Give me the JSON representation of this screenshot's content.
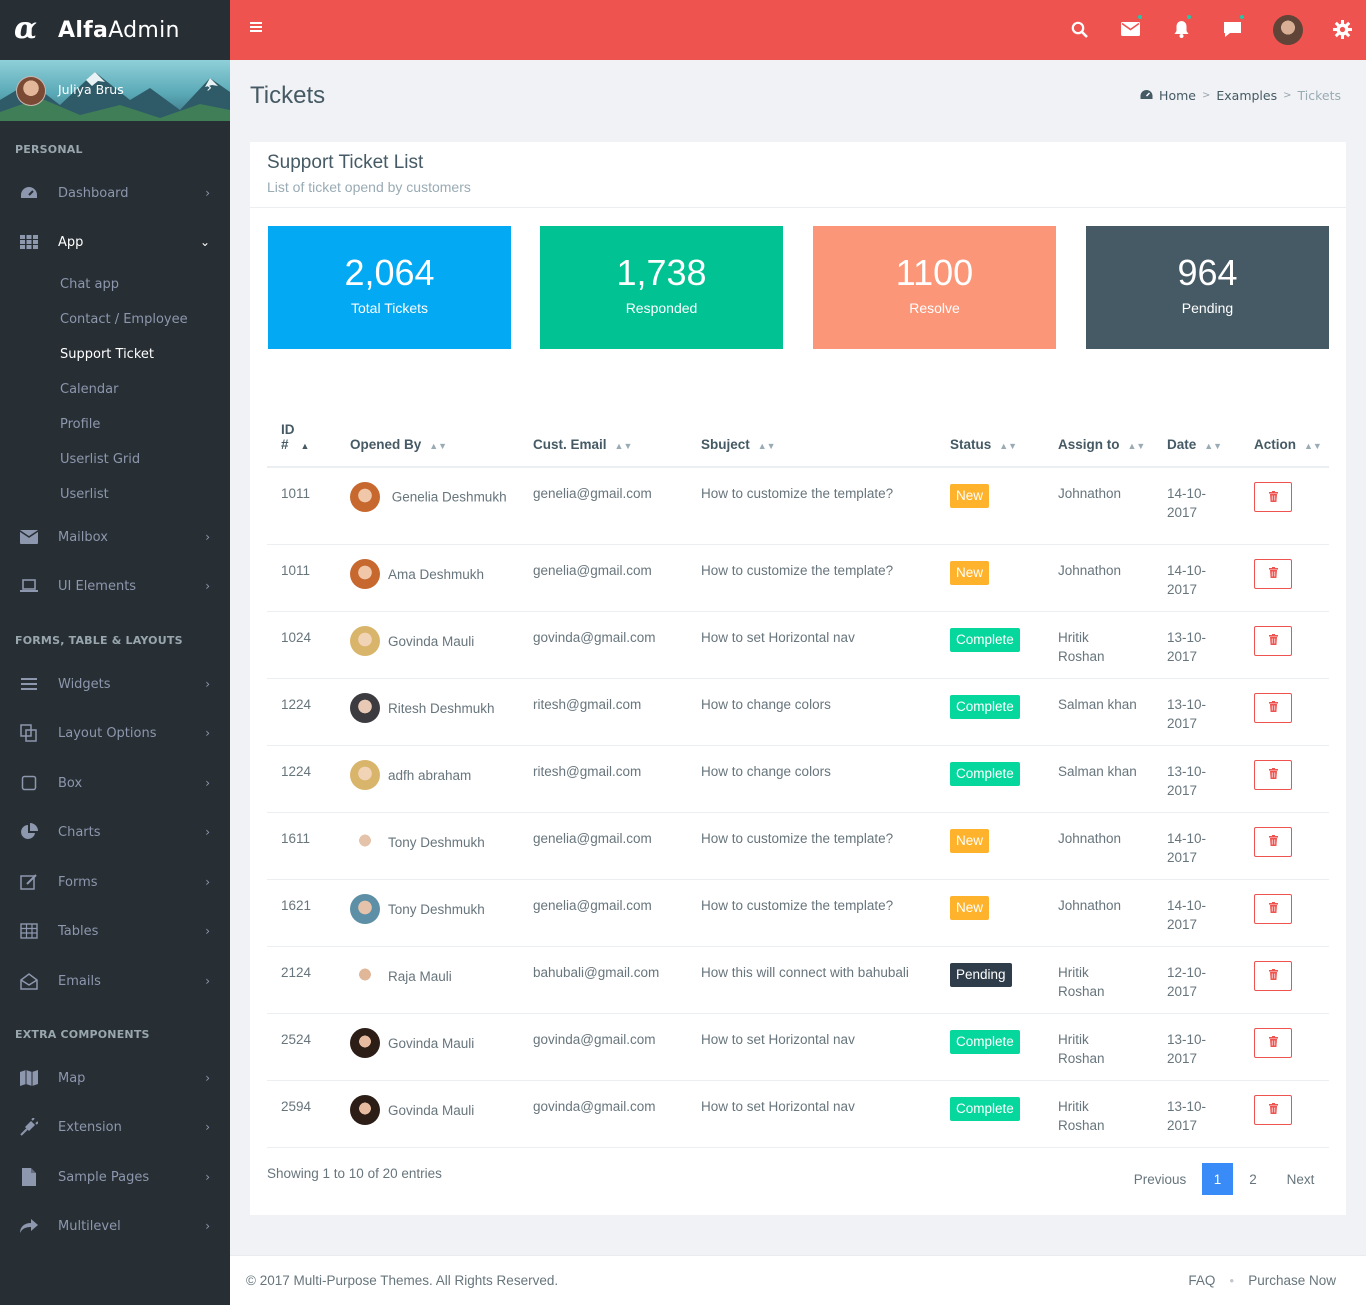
{
  "brand": {
    "name_bold": "Alfa",
    "name_light": "Admin"
  },
  "user": {
    "name": "Juliya Brus"
  },
  "sidebar": {
    "sections": [
      "PERSONAL",
      "FORMS, TABLE & LAYOUTS",
      "EXTRA COMPONENTS"
    ],
    "items": [
      {
        "label": "Dashboard",
        "icon": "dashboard-icon"
      },
      {
        "label": "App",
        "icon": "grid-icon"
      },
      {
        "label": "Mailbox",
        "icon": "envelope-icon"
      },
      {
        "label": "UI Elements",
        "icon": "laptop-icon"
      },
      {
        "label": "Widgets",
        "icon": "bars-icon"
      },
      {
        "label": "Layout Options",
        "icon": "copy-icon"
      },
      {
        "label": "Box",
        "icon": "square-icon"
      },
      {
        "label": "Charts",
        "icon": "pie-chart-icon"
      },
      {
        "label": "Forms",
        "icon": "edit-icon"
      },
      {
        "label": "Tables",
        "icon": "table-icon"
      },
      {
        "label": "Emails",
        "icon": "envelope-open-icon"
      },
      {
        "label": "Map",
        "icon": "map-icon"
      },
      {
        "label": "Extension",
        "icon": "plug-icon"
      },
      {
        "label": "Sample Pages",
        "icon": "file-icon"
      },
      {
        "label": "Multilevel",
        "icon": "share-icon"
      }
    ],
    "app_sub": [
      "Chat app",
      "Contact / Employee",
      "Support Ticket",
      "Calendar",
      "Profile",
      "Userlist Grid",
      "Userlist"
    ]
  },
  "page": {
    "title": "Tickets",
    "breadcrumb": [
      "Home",
      "Examples",
      "Tickets"
    ]
  },
  "card": {
    "title": "Support Ticket List",
    "subtitle": "List of ticket opend by customers"
  },
  "stats": [
    {
      "value": "2,064",
      "label": "Total Tickets",
      "color": "#03a9f3"
    },
    {
      "value": "1,738",
      "label": "Responded",
      "color": "#00c292"
    },
    {
      "value": "1100",
      "label": "Resolve",
      "color": "#fb9678"
    },
    {
      "value": "964",
      "label": "Pending",
      "color": "#455a64"
    }
  ],
  "table": {
    "headers": {
      "id_line1": "ID",
      "id_line2": "#",
      "opened_by": "Opened By",
      "email": "Cust. Email",
      "subject": "Sbuject",
      "status": "Status",
      "assign": "Assign to",
      "date": "Date",
      "action": "Action"
    },
    "rows": [
      {
        "id": "1011",
        "name": "Genelia Deshmukh",
        "email": "genelia@gmail.com",
        "subject": "How to customize the template?",
        "status": "New",
        "assign": "Johnathon",
        "date": "14-10-2017"
      },
      {
        "id": "1011",
        "name": "Ama Deshmukh",
        "email": "genelia@gmail.com",
        "subject": "How to customize the template?",
        "status": "New",
        "assign": "Johnathon",
        "date": "14-10-2017"
      },
      {
        "id": "1024",
        "name": "Govinda Mauli",
        "email": "govinda@gmail.com",
        "subject": "How to set Horizontal nav",
        "status": "Complete",
        "assign": "Hritik Roshan",
        "date": "13-10-2017"
      },
      {
        "id": "1224",
        "name": "Ritesh Deshmukh",
        "email": "ritesh@gmail.com",
        "subject": "How to change colors",
        "status": "Complete",
        "assign": "Salman khan",
        "date": "13-10-2017"
      },
      {
        "id": "1224",
        "name": "adfh abraham",
        "email": "ritesh@gmail.com",
        "subject": "How to change colors",
        "status": "Complete",
        "assign": "Salman khan",
        "date": "13-10-2017"
      },
      {
        "id": "1611",
        "name": "Tony Deshmukh",
        "email": "genelia@gmail.com",
        "subject": "How to customize the template?",
        "status": "New",
        "assign": "Johnathon",
        "date": "14-10-2017"
      },
      {
        "id": "1621",
        "name": "Tony Deshmukh",
        "email": "genelia@gmail.com",
        "subject": "How to customize the template?",
        "status": "New",
        "assign": "Johnathon",
        "date": "14-10-2017"
      },
      {
        "id": "2124",
        "name": "Raja Mauli",
        "email": "bahubali@gmail.com",
        "subject": "How this will connect with bahubali",
        "status": "Pending",
        "assign": "Hritik Roshan",
        "date": "12-10-2017"
      },
      {
        "id": "2524",
        "name": "Govinda Mauli",
        "email": "govinda@gmail.com",
        "subject": "How to set Horizontal nav",
        "status": "Complete",
        "assign": "Hritik Roshan",
        "date": "13-10-2017"
      },
      {
        "id": "2594",
        "name": "Govinda Mauli",
        "email": "govinda@gmail.com",
        "subject": "How to set Horizontal nav",
        "status": "Complete",
        "assign": "Hritik Roshan",
        "date": "13-10-2017"
      }
    ]
  },
  "pagination": {
    "info": "Showing 1 to 10 of 20 entries",
    "previous": "Previous",
    "pages": [
      "1",
      "2"
    ],
    "current": "1",
    "next": "Next"
  },
  "footer": {
    "copyright": "© 2017 Multi-Purpose Themes. All Rights Reserved.",
    "links": [
      "FAQ",
      "Purchase Now"
    ]
  }
}
